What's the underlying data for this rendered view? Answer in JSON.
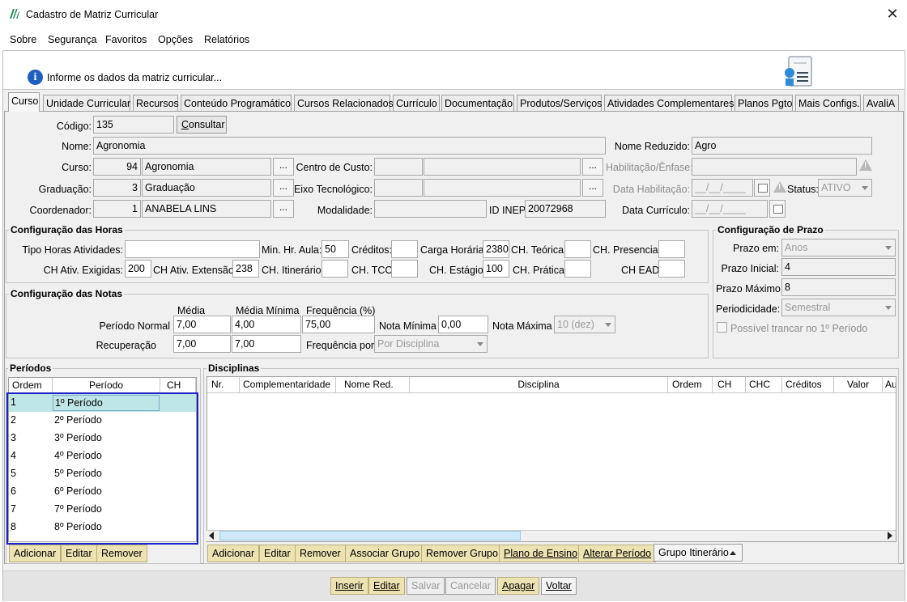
{
  "window": {
    "title": "Cadastro de Matriz Curricular",
    "close": "✕"
  },
  "menu": [
    "Sobre",
    "Segurança",
    "Favoritos",
    "Opções",
    "Relatórios"
  ],
  "info": {
    "text": "Informe os dados da matriz curricular..."
  },
  "tabs": [
    "Curso",
    "Unidade Curricular",
    "Recursos",
    "Conteúdo Programático",
    "Cursos Relacionados",
    "Currículo",
    "Documentação",
    "Produtos/Serviços",
    "Atividades Complementares",
    "Planos Pgto",
    "Mais Configs.",
    "AvaliA"
  ],
  "form": {
    "codigo_label": "Código:",
    "codigo": "135",
    "consultar": "Consultar",
    "nome_label": "Nome:",
    "nome": "Agronomia",
    "nome_reduzido_label": "Nome Reduzido:",
    "nome_reduzido": "Agro",
    "curso_label": "Curso:",
    "curso_id": "94",
    "curso_nome": "Agronomia",
    "centro_custo_label": "Centro de Custo:",
    "habilitacao_label": "Habilitação/Ênfase:",
    "graduacao_label": "Graduação:",
    "graduacao_id": "3",
    "graduacao_nome": "Graduação",
    "eixo_label": "Eixo Tecnológico:",
    "data_habilitacao_label": "Data Habilitação:",
    "data_habilitacao": "__/__/____",
    "status_label": "Status:",
    "status": "ATIVO",
    "coordenador_label": "Coordenador:",
    "coordenador_id": "1",
    "coordenador_nome": "ANABELA LINS",
    "modalidade_label": "Modalidade:",
    "id_inep_label": "ID INEP:",
    "id_inep": "20072968",
    "data_curriculo_label": "Data Currículo:",
    "data_curriculo": "__/__/____",
    "ellipsis": "..."
  },
  "horas": {
    "title": "Configuração das Horas",
    "tipo_label": "Tipo Horas Atividades:",
    "tipo": "",
    "min_hr_aula_label": "Min. Hr. Aula:",
    "min_hr_aula": "50",
    "creditos_label": "Créditos:",
    "creditos": "",
    "carga_label": "Carga Horária:",
    "carga": "2380",
    "ch_teorica_label": "CH. Teórica:",
    "ch_teorica": "",
    "ch_presencial_label": "CH. Presencial:",
    "ch_presencial": "",
    "ch_ativ_exig_label": "CH Ativ. Exigidas:",
    "ch_ativ_exig": "200",
    "ch_ativ_ext_label": "CH Ativ. Extensão:",
    "ch_ativ_ext": "238",
    "ch_itinerario_label": "CH. Itinerário:",
    "ch_itinerario": "",
    "ch_tcc_label": "CH. TCC:",
    "ch_tcc": "",
    "ch_estagio_label": "CH. Estágio:",
    "ch_estagio": "100",
    "ch_pratica_label": "CH. Prática:",
    "ch_pratica": "",
    "ch_ead_label": "CH EAD:",
    "ch_ead": ""
  },
  "notas": {
    "title": "Configuração das Notas",
    "media_header": "Média",
    "media_min_header": "Média Mínima",
    "freq_header": "Frequência (%)",
    "periodo_normal_label": "Período Normal",
    "pn_media": "7,00",
    "pn_media_min": "4,00",
    "pn_freq": "75,00",
    "nota_minima_label": "Nota Mínima",
    "nota_minima": "0,00",
    "nota_maxima_label": "Nota Máxima",
    "nota_maxima": "10 (dez)",
    "recuperacao_label": "Recuperação",
    "rec_media": "7,00",
    "rec_media_min": "7,00",
    "freq_por_label": "Frequência por:",
    "freq_por": "Por Disciplina"
  },
  "prazo": {
    "title": "Configuração de Prazo",
    "prazo_em_label": "Prazo em:",
    "prazo_em": "Anos",
    "prazo_inicial_label": "Prazo Inicial:",
    "prazo_inicial": "4",
    "prazo_maximo_label": "Prazo Máximo:",
    "prazo_maximo": "8",
    "periodicidade_label": "Periodicidade:",
    "periodicidade": "Semestral",
    "trancar_label": "Possível trancar no 1º Período"
  },
  "periodos": {
    "title": "Períodos",
    "headers": [
      "Ordem",
      "Período",
      "CH"
    ],
    "rows": [
      {
        "ordem": "1",
        "periodo": "1º Período"
      },
      {
        "ordem": "2",
        "periodo": "2º Período"
      },
      {
        "ordem": "3",
        "periodo": "3º Período"
      },
      {
        "ordem": "4",
        "periodo": "4º Período"
      },
      {
        "ordem": "5",
        "periodo": "5º Período"
      },
      {
        "ordem": "6",
        "periodo": "6º Período"
      },
      {
        "ordem": "7",
        "periodo": "7º Período"
      },
      {
        "ordem": "8",
        "periodo": "8º Período"
      }
    ],
    "buttons": [
      "Adicionar",
      "Editar",
      "Remover"
    ]
  },
  "disciplinas": {
    "title": "Disciplinas",
    "headers": [
      "Nr.",
      "Complementaridade",
      "Nome Red.",
      "Disciplina",
      "Ordem",
      "CH",
      "CHC",
      "Créditos",
      "Valor",
      "Au"
    ],
    "buttons": [
      "Adicionar",
      "Editar",
      "Remover",
      "Associar Grupo",
      "Remover Grupo",
      "Plano de Ensino",
      "Alterar Período",
      "Grupo Itinerário"
    ]
  },
  "bottom_buttons": [
    "Inserir",
    "Editar",
    "Salvar",
    "Cancelar",
    "Apagar",
    "Voltar"
  ]
}
